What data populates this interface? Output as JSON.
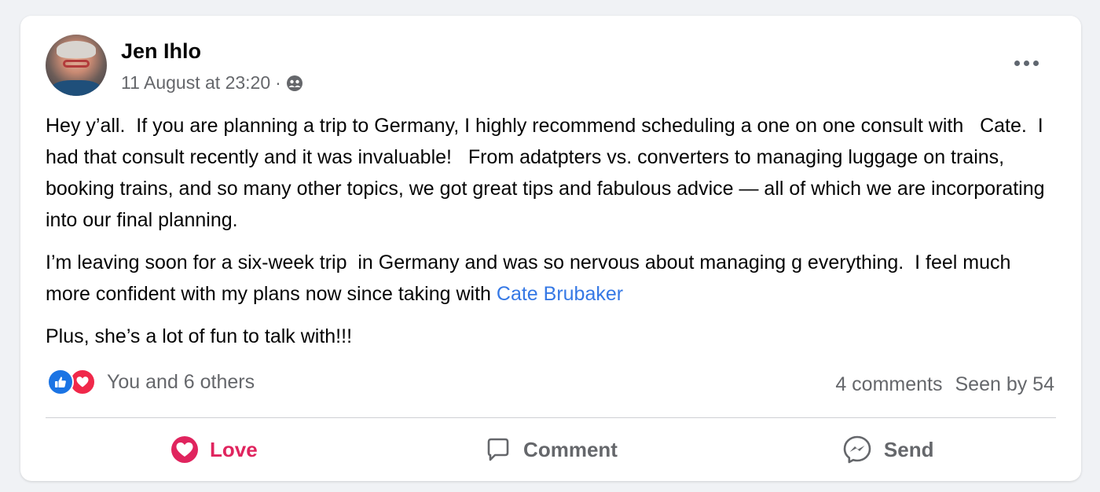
{
  "post": {
    "author": "Jen Ihlo",
    "timestamp": "11 August at 23:20",
    "separator": "·",
    "audience_icon": "group-icon",
    "paragraph1": "Hey y’all.  If you are planning a trip to Germany, I highly recommend scheduling a one on one consult with   Cate.  I had that consult recently and it was invaluable!   From adatpters vs. converters to managing luggage on trains, booking trains, and so many other topics, we got great tips and fabulous advice — all of which we are incorporating into our final planning.",
    "paragraph2_text": "I’m leaving soon for a six-week trip  in Germany and was so nervous about managing g everything.  I feel much more confident with my plans now since taking with ",
    "paragraph2_mention": "Cate Brubaker",
    "paragraph3": "Plus, she’s a lot of fun to talk with!!!"
  },
  "reactions": {
    "icons": [
      "like-icon",
      "love-icon"
    ],
    "summary": "You and 6 others"
  },
  "stats": {
    "comments": "4 comments",
    "seen": "Seen by 54"
  },
  "actions": {
    "love": "Love",
    "comment": "Comment",
    "send": "Send"
  },
  "colors": {
    "love": "#e0245e",
    "link": "#3578e5",
    "like_blue": "#1b74e4",
    "secondary_text": "#65676b"
  }
}
